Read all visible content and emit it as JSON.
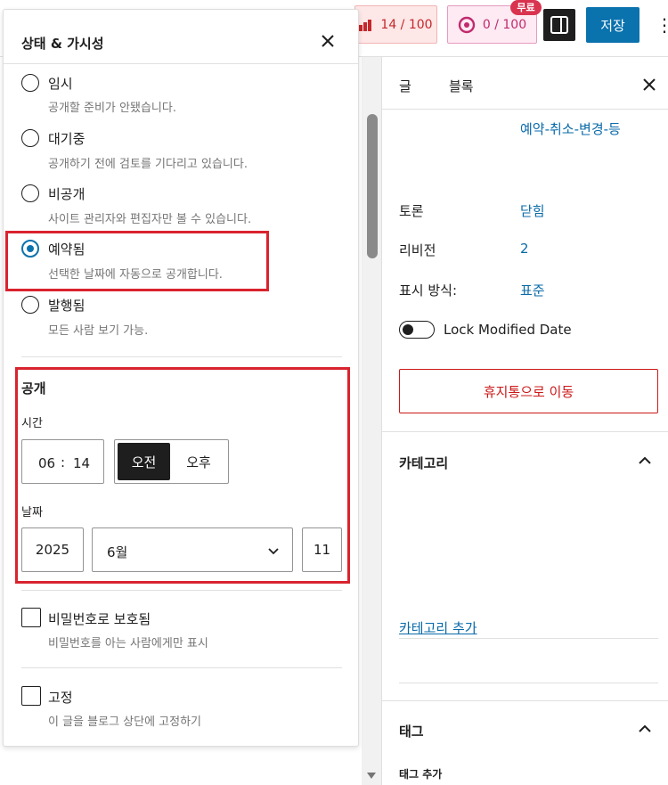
{
  "toolbar": {
    "seo_score": "14 / 100",
    "ai_score": "0 / 100",
    "ai_badge_pill": "무료",
    "save_label": "저장",
    "more_label": "⋮"
  },
  "sidebar": {
    "tabs": [
      "글",
      "블록"
    ],
    "cut_off_slug": "예약-취소-변경-등",
    "meta": [
      {
        "label": "토론",
        "value": "닫힘"
      },
      {
        "label": "리비전",
        "value": "2"
      },
      {
        "label": "표시 방식:",
        "value": "표준"
      }
    ],
    "lock_modified_label": "Lock Modified Date",
    "trash_label": "휴지통으로 이동",
    "categories_title": "카테고리",
    "add_category_link": "카테고리 추가",
    "tags_title": "태그",
    "add_tag_label": "태그 추가"
  },
  "popover": {
    "title": "상태 & 가시성",
    "options": [
      {
        "label": "임시",
        "desc": "공개할 준비가 안됐습니다."
      },
      {
        "label": "대기중",
        "desc": "공개하기 전에 검토를 기다리고 있습니다."
      },
      {
        "label": "비공개",
        "desc": "사이트 관리자와 편집자만 볼 수 있습니다."
      },
      {
        "label": "예약됨",
        "desc": "선택한 날짜에 자동으로 공개합니다."
      },
      {
        "label": "발행됨",
        "desc": "모든 사람 보기 가능."
      }
    ],
    "selected": "예약됨",
    "publish": {
      "title": "공개",
      "time_label": "시간",
      "hour": "06",
      "minute": "14",
      "separator": ":",
      "am": "오전",
      "pm": "오후",
      "date_label": "날짜",
      "year": "2025",
      "month": "6월",
      "day": "11"
    },
    "password": {
      "label": "비밀번호로 보호됨",
      "desc": "비밀번호를 아는 사람에게만 표시"
    },
    "sticky": {
      "label": "고정",
      "desc": "이 글을 블로그 상단에 고정하기"
    }
  },
  "colors": {
    "accent": "#0a72ad",
    "highlight": "#d9232e",
    "danger": "#cc1818"
  }
}
